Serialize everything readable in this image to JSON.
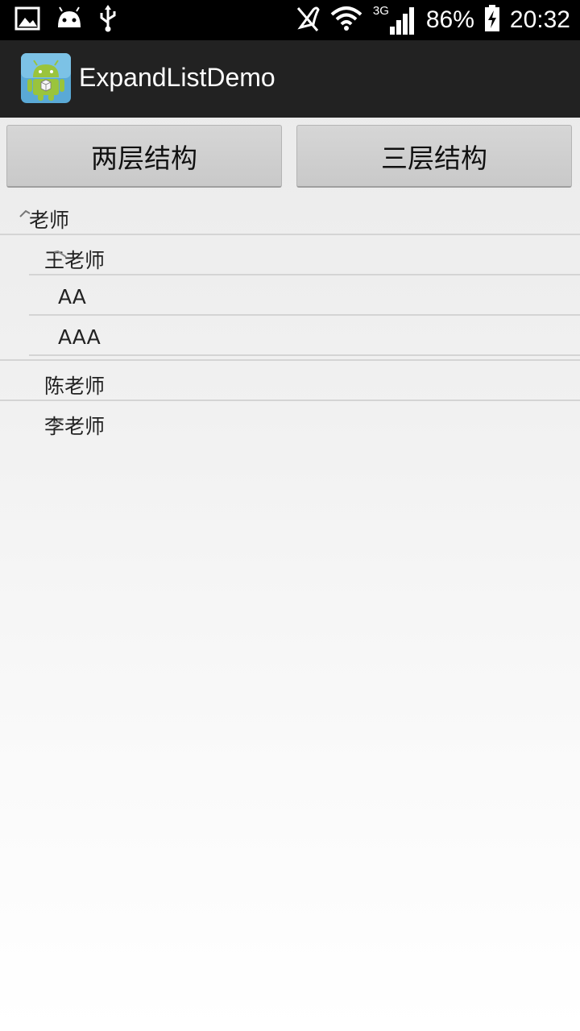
{
  "status_bar": {
    "battery_percent": "86%",
    "time": "20:32",
    "network_type": "3G",
    "icons_left": [
      "image-icon",
      "android-icon",
      "usb-icon"
    ],
    "icons_right": [
      "mute-icon",
      "wifi-icon",
      "signal-icon",
      "battery-charging-icon"
    ]
  },
  "action_bar": {
    "title": "ExpandListDemo",
    "icon": "android-app-icon"
  },
  "buttons": {
    "two_level": "两层结构",
    "three_level": "三层结构"
  },
  "tree": {
    "group": "老师",
    "children": [
      {
        "label": "王老师",
        "expanded": true,
        "children": [
          "AA",
          "AAA"
        ]
      },
      {
        "label": "陈老师",
        "expanded": false
      },
      {
        "label": "李老师",
        "expanded": false
      }
    ]
  },
  "colors": {
    "status_bar_bg": "#000000",
    "action_bar_bg": "#222222",
    "button_bg": "#cfcfcf",
    "divider": "#d4d4d4"
  }
}
